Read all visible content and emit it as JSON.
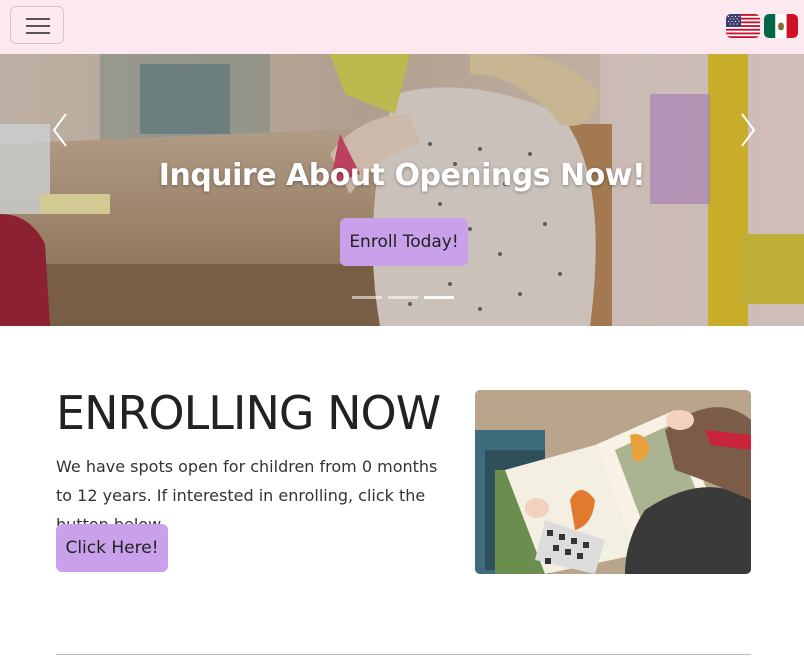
{
  "header": {
    "menu_icon": "hamburger-menu-icon",
    "languages": [
      {
        "icon": "us-flag-icon"
      },
      {
        "icon": "mexico-flag-icon"
      }
    ]
  },
  "hero": {
    "heading": "Inquire About Openings Now!",
    "button_label": "Enroll Today!",
    "prev_icon": "chevron-left-icon",
    "next_icon": "chevron-right-icon",
    "slide_count": 3,
    "active_slide": 3
  },
  "enrolling": {
    "title": "ENROLLING NOW",
    "description": "We have spots open for children from 0 months to 12 years. If interested in enrolling, click the button below.",
    "button_label": "Click Here!"
  },
  "colors": {
    "header_bg": "#fce8ef",
    "button_bg": "#c9a1ea",
    "text_dark": "#222222"
  }
}
